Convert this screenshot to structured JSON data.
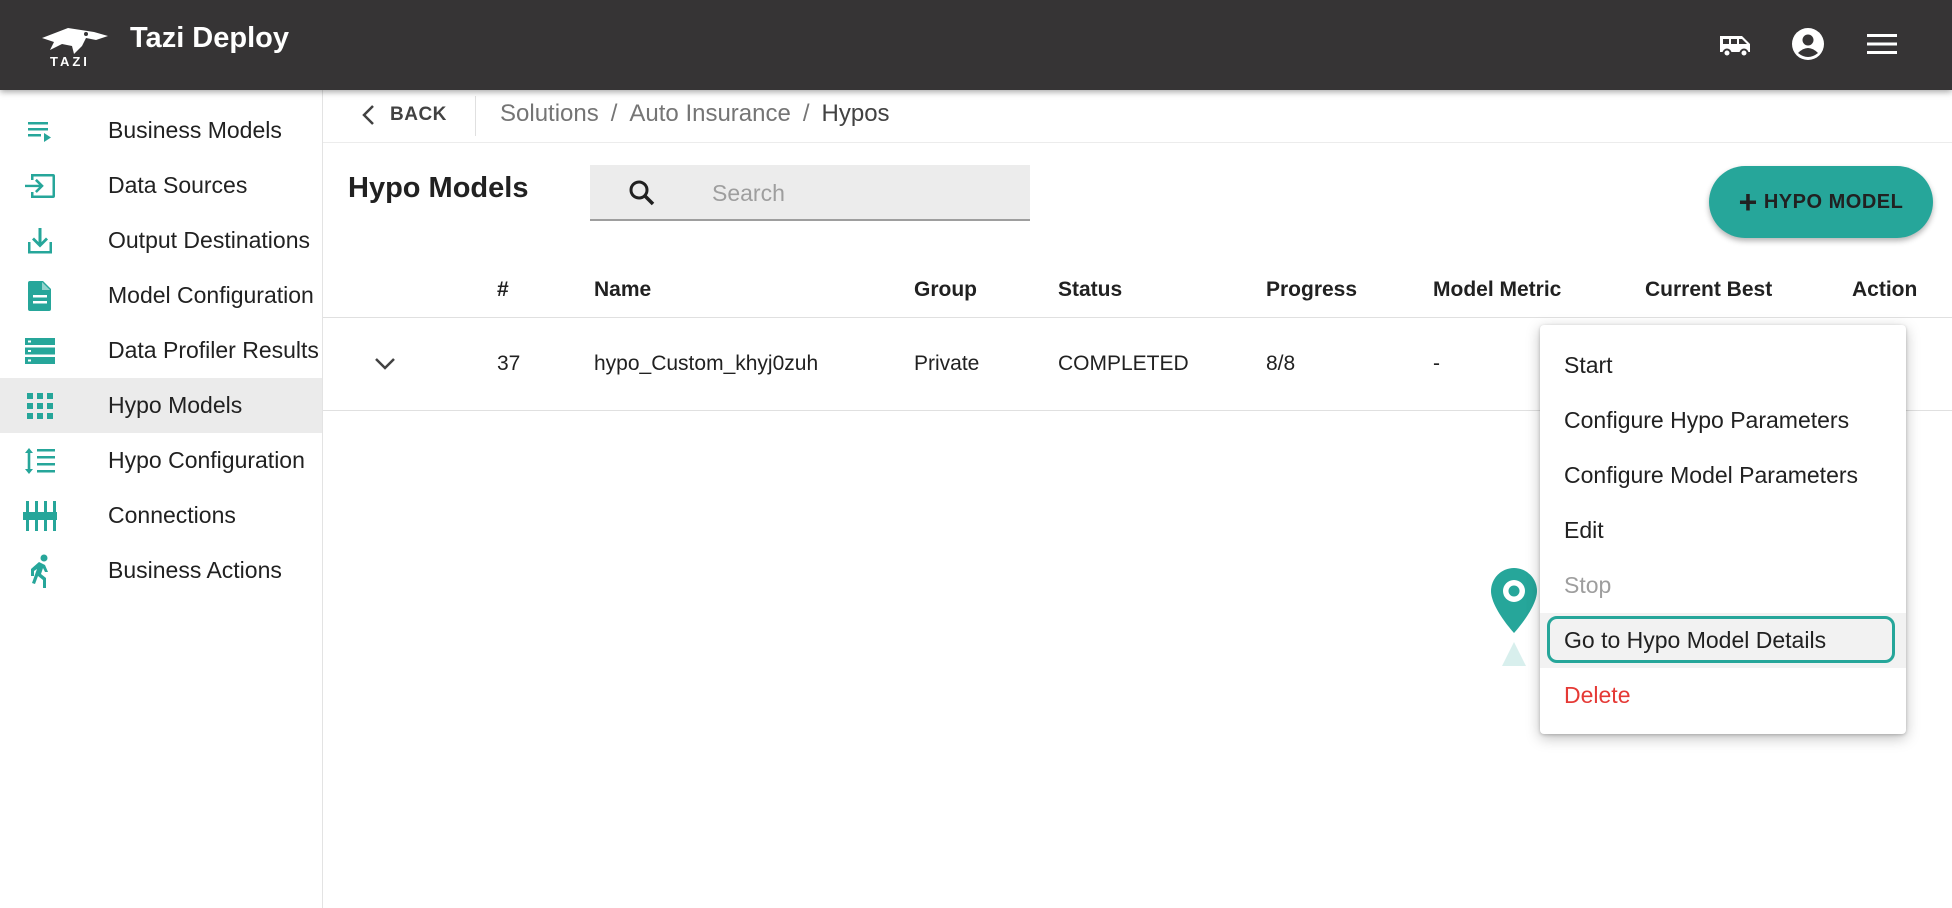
{
  "app": {
    "title": "Tazi Deploy",
    "logo_text": "TAZI"
  },
  "topbar": {
    "icons": [
      "van-icon",
      "account-circle-icon",
      "menu-icon"
    ]
  },
  "sidebar": {
    "items": [
      {
        "label": "Business Models",
        "icon": "playlist-icon",
        "active": false
      },
      {
        "label": "Data Sources",
        "icon": "input-icon",
        "active": false
      },
      {
        "label": "Output Destinations",
        "icon": "download-icon",
        "active": false
      },
      {
        "label": "Model Configuration",
        "icon": "document-icon",
        "active": false
      },
      {
        "label": "Data Profiler Results",
        "icon": "storage-icon",
        "active": false
      },
      {
        "label": "Hypo Models",
        "icon": "apps-grid-icon",
        "active": true
      },
      {
        "label": "Hypo Configuration",
        "icon": "line-spacing-icon",
        "active": false
      },
      {
        "label": "Connections",
        "icon": "tune-icon",
        "active": false
      },
      {
        "label": "Business Actions",
        "icon": "running-icon",
        "active": false
      }
    ]
  },
  "header": {
    "back_label": "BACK",
    "breadcrumb": [
      "Solutions",
      "Auto Insurance",
      "Hypos"
    ],
    "separator": "/"
  },
  "main": {
    "heading": "Hypo Models",
    "search_placeholder": "Search",
    "search_value": "",
    "add_button_label": "HYPO MODEL"
  },
  "table": {
    "columns": [
      "#",
      "Name",
      "Group",
      "Status",
      "Progress",
      "Model Metric",
      "Current Best",
      "Action"
    ],
    "rows": [
      {
        "id": "37",
        "name": "hypo_Custom_khyj0zuh",
        "group": "Private",
        "status": "COMPLETED",
        "progress": "8/8",
        "model_metric": "-"
      }
    ]
  },
  "context_menu": {
    "items": [
      {
        "label": "Start",
        "state": "normal"
      },
      {
        "label": "Configure Hypo Parameters",
        "state": "normal"
      },
      {
        "label": "Configure Model Parameters",
        "state": "normal"
      },
      {
        "label": "Edit",
        "state": "normal"
      },
      {
        "label": "Stop",
        "state": "disabled"
      },
      {
        "label": "Go to Hypo Model Details",
        "state": "focused"
      },
      {
        "label": "Delete",
        "state": "danger"
      }
    ]
  },
  "colors": {
    "accent": "#26a69a",
    "topbar": "#363435",
    "danger": "#e53935",
    "disabled": "#9e9e9e"
  }
}
